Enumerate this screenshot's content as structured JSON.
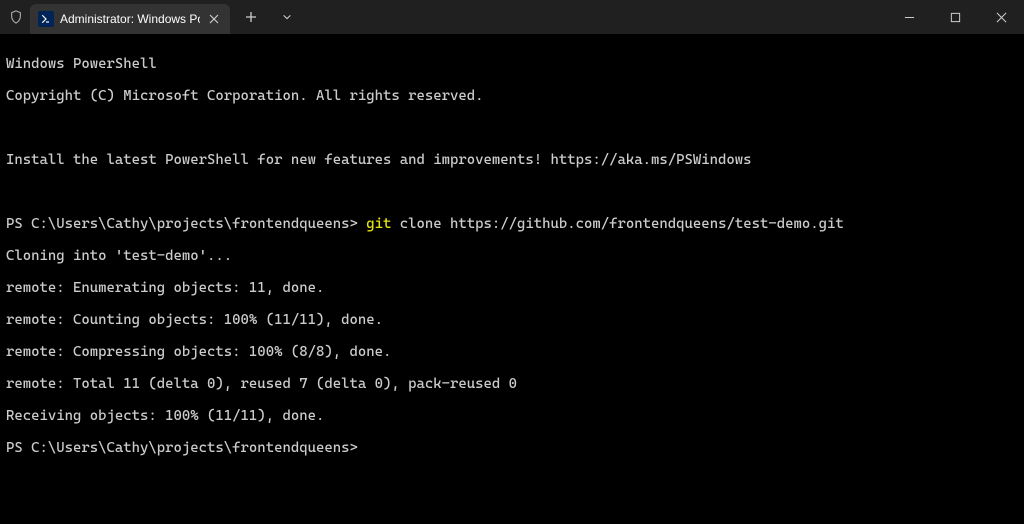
{
  "titlebar": {
    "tab_title": "Administrator: Windows Powe",
    "new_tab_label": "+",
    "dropdown_label": "v"
  },
  "terminal": {
    "banner_line1": "Windows PowerShell",
    "banner_line2": "Copyright (C) Microsoft Corporation. All rights reserved.",
    "install_msg": "Install the latest PowerShell for new features and improvements! https://aka.ms/PSWindows",
    "prompt1_path": "PS C:\\Users\\Cathy\\projects\\frontendqueens> ",
    "cmd_keyword": "git",
    "cmd_rest": " clone https://github.com/frontendqueens/test-demo.git",
    "out1": "Cloning into 'test-demo'...",
    "out2": "remote: Enumerating objects: 11, done.",
    "out3": "remote: Counting objects: 100% (11/11), done.",
    "out4": "remote: Compressing objects: 100% (8/8), done.",
    "out5": "remote: Total 11 (delta 0), reused 7 (delta 0), pack-reused 0",
    "out6": "Receiving objects: 100% (11/11), done.",
    "prompt2_path": "PS C:\\Users\\Cathy\\projects\\frontendqueens>"
  }
}
